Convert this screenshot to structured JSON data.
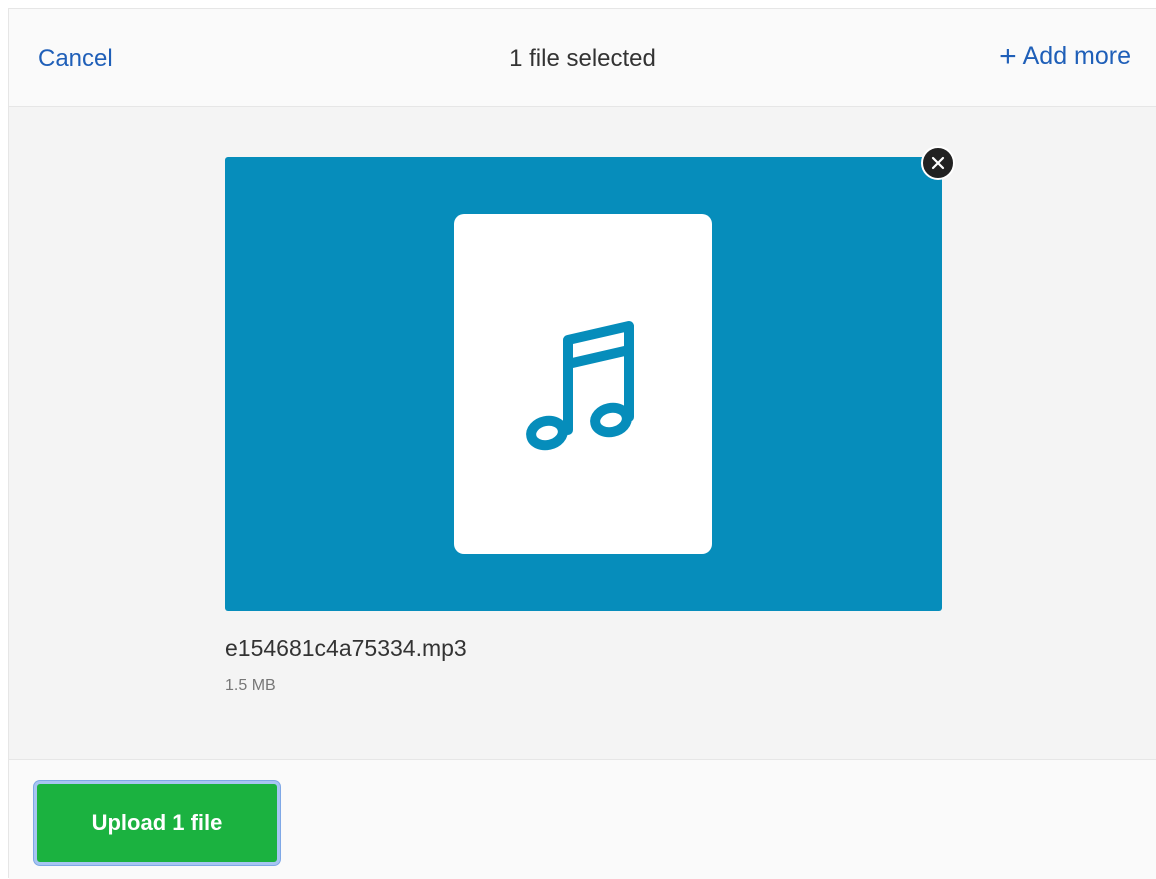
{
  "header": {
    "cancel_label": "Cancel",
    "title": "1 file selected",
    "add_more_label": "Add more",
    "add_more_icon": "plus-icon"
  },
  "file": {
    "name": "e154681c4a75334.mp3",
    "size": "1.5 MB",
    "type_icon": "music-note-icon",
    "preview_color": "#068dbb",
    "remove_icon": "close-icon"
  },
  "footer": {
    "upload_label": "Upload 1 file",
    "upload_color": "#1bb240"
  },
  "colors": {
    "accent": "#1f5fb8",
    "background": "#f4f4f4"
  }
}
